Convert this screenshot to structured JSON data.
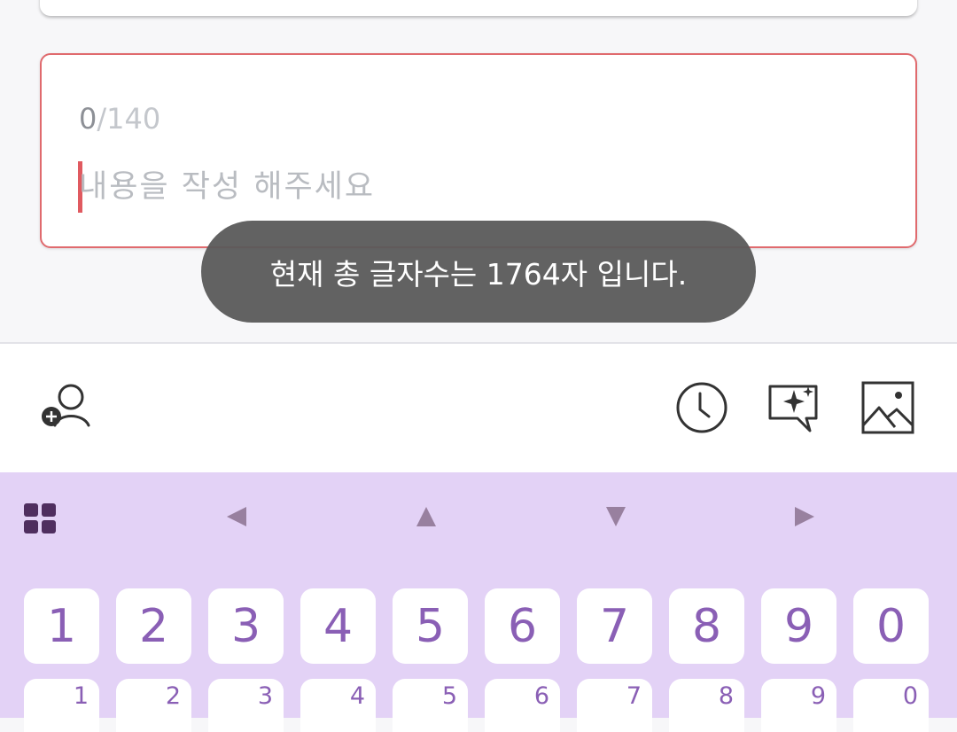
{
  "composer": {
    "count_current": "0",
    "count_max": "/140",
    "placeholder": "내용을 작성 해주세요"
  },
  "toast": {
    "message": "현재 총 글자수는 1764자 입니다."
  },
  "toolbar": {
    "icons": [
      "add-person-icon",
      "clock-icon",
      "ai-chat-sparkle-icon",
      "image-icon"
    ]
  },
  "keyboard": {
    "top_icons": [
      "grid-menu-icon",
      "arrow-left-icon",
      "arrow-up-icon",
      "arrow-down-icon",
      "arrow-right-icon"
    ],
    "number_row": [
      "1",
      "2",
      "3",
      "4",
      "5",
      "6",
      "7",
      "8",
      "9",
      "0"
    ],
    "second_row_hints": [
      "1",
      "2",
      "3",
      "4",
      "5",
      "6",
      "7",
      "8",
      "9",
      "0"
    ]
  },
  "colors": {
    "accent_border": "#e06a6e",
    "keyboard_bg": "#e3d2f6",
    "key_text": "#8a5fb5",
    "toast_bg": "#5a5a5a"
  }
}
